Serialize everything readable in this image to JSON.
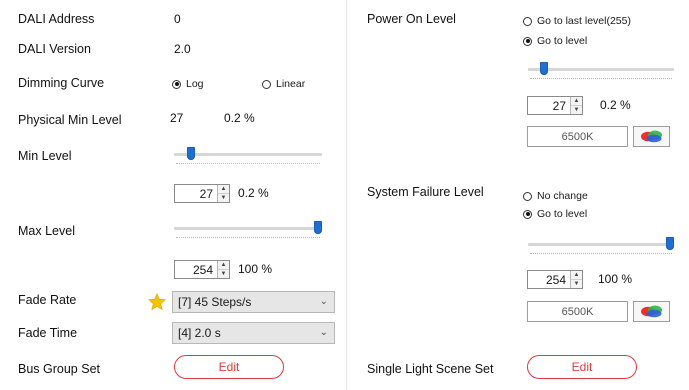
{
  "left": {
    "dali_address": {
      "label": "DALI Address",
      "value": "0"
    },
    "dali_version": {
      "label": "DALI Version",
      "value": "2.0"
    },
    "dimming_curve": {
      "label": "Dimming Curve",
      "options": [
        "Log",
        "Linear"
      ],
      "selected": "Log"
    },
    "physical_min": {
      "label": "Physical Min Level",
      "value": "27",
      "percent": "0.2 %"
    },
    "min_level": {
      "label": "Min Level",
      "value": "27",
      "percent": "0.2 %",
      "slider_fraction": 0.09
    },
    "max_level": {
      "label": "Max Level",
      "value": "254",
      "percent": "100 %",
      "slider_fraction": 1.0
    },
    "fade_rate": {
      "label": "Fade Rate",
      "value": "[7] 45 Steps/s",
      "favorite": true
    },
    "fade_time": {
      "label": "Fade Time",
      "value": "[4] 2.0 s"
    },
    "bus_group": {
      "label": "Bus Group Set",
      "button": "Edit"
    }
  },
  "right": {
    "power_on": {
      "label": "Power On Level",
      "options": [
        "Go to last level(255)",
        "Go to level"
      ],
      "selected": "Go to level",
      "value": "27",
      "percent": "0.2 %",
      "slider_fraction": 0.09,
      "color_temp": "6500K"
    },
    "system_failure": {
      "label": "System Failure Level",
      "options": [
        "No change",
        "Go to level"
      ],
      "selected": "Go to level",
      "value": "254",
      "percent": "100 %",
      "slider_fraction": 1.0,
      "color_temp": "6500K"
    },
    "single_scene": {
      "label": "Single Light Scene Set",
      "button": "Edit"
    }
  },
  "colors": {
    "accent": "#1f6fd1",
    "edit_red": "#e23b3b",
    "star": "#f5c400"
  }
}
